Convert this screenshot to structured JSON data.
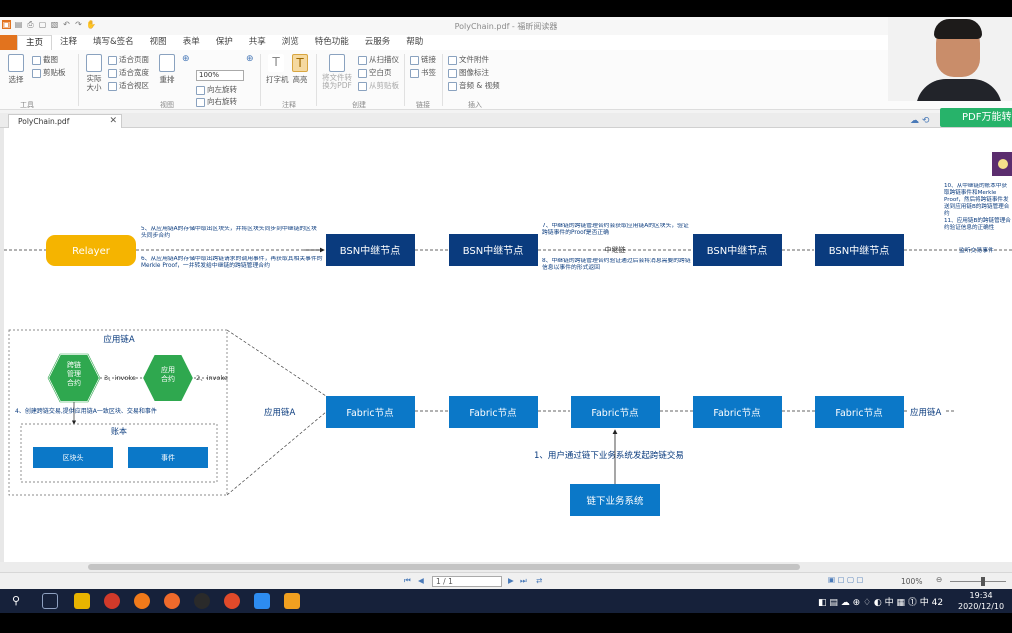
{
  "window": {
    "title": "PolyChain.pdf - 福昕阅读器"
  },
  "menu": {
    "items": [
      "主页",
      "注释",
      "填写&签名",
      "视图",
      "表单",
      "保护",
      "共享",
      "浏览",
      "特色功能",
      "云服务",
      "帮助"
    ]
  },
  "ribbon": {
    "hand": "选择",
    "snapshot": "截图",
    "clipboard": "剪贴板",
    "actual_size": "实际\n大小",
    "fit_page": "适合页面",
    "fit_width": "适合宽度",
    "fit_visible": "适合视区",
    "reflow": "重排",
    "zoom_value": "100%",
    "rotate_left": "向左旋转",
    "rotate_right": "向右旋转",
    "typewriter": "打字机",
    "highlight": "高亮",
    "from_file": "将文件转换为PDF",
    "from_scanner": "从扫描仪",
    "blank": "空白页",
    "from_clipboard": "从剪贴板",
    "link": "链接",
    "bookmark": "书签",
    "file_attach": "文件附件",
    "image_annot": "图像标注",
    "audio_video": "音频 & 视频",
    "groups": [
      "工具",
      "视图",
      "注释",
      "创建",
      "链接",
      "插入"
    ]
  },
  "tab": {
    "filename": "PolyChain.pdf"
  },
  "pdf_button": "PDF万能转",
  "diagram": {
    "relayer": "Relayer",
    "bsn_node": "BSN中继节点",
    "fabric_node": "Fabric节点",
    "note5": "5、从应用链A的存储中取出区块头，并将区块头同步到中继链的区块头同步合约",
    "note6": "6、从应用链A的存储中取出跨链请求的调用事件，再获取其相关事件的Merkle Proof，一并转发给中继链的跨链管理合约",
    "note7": "7、中继链的跨链管理合约会获取应用链A的区块头，验证跨链事件的Proof是否正确",
    "note8": "8、中继链的跨链管理合约验证通过后会将消息需要的跨链信息以事件的形式返回",
    "relay_chain": "中继链",
    "note10": "10、从中继链的账本中获取跨链事件和Merkle Proof，然后将跨链事件发送到应用链B的跨链管理合约",
    "note11": "11、应用链B的跨链管理合约验证信息的正确性",
    "right_label": "监听交易事件",
    "app_chain_a": "应用链A",
    "app_chain_a_right": "应用链A",
    "contract1": "跨链\n管理\n合约",
    "contract2": "应用\n合约",
    "invoke3": "3、invoke",
    "invoke2": "2、invoke",
    "note4": "4、创建跨链交易,提供应用链A一致区块、交易和事件",
    "ledger": "账本",
    "block_header": "区块头",
    "event": "事件",
    "step1": "1、用户通过链下业务系统发起跨链交易",
    "offchain_system": "链下业务系统"
  },
  "status": {
    "page": "1 / 1",
    "zoom": "100%"
  },
  "clock": {
    "time": "19:34",
    "date": "2020/12/10"
  },
  "tray": {
    "ime": "中",
    "num": "42"
  },
  "colors": {
    "navy": "#0a3b7e",
    "blue": "#0b78c8",
    "relayer": "#f5b400",
    "green": "#2fa84f",
    "pdf_green": "#27b36a"
  }
}
